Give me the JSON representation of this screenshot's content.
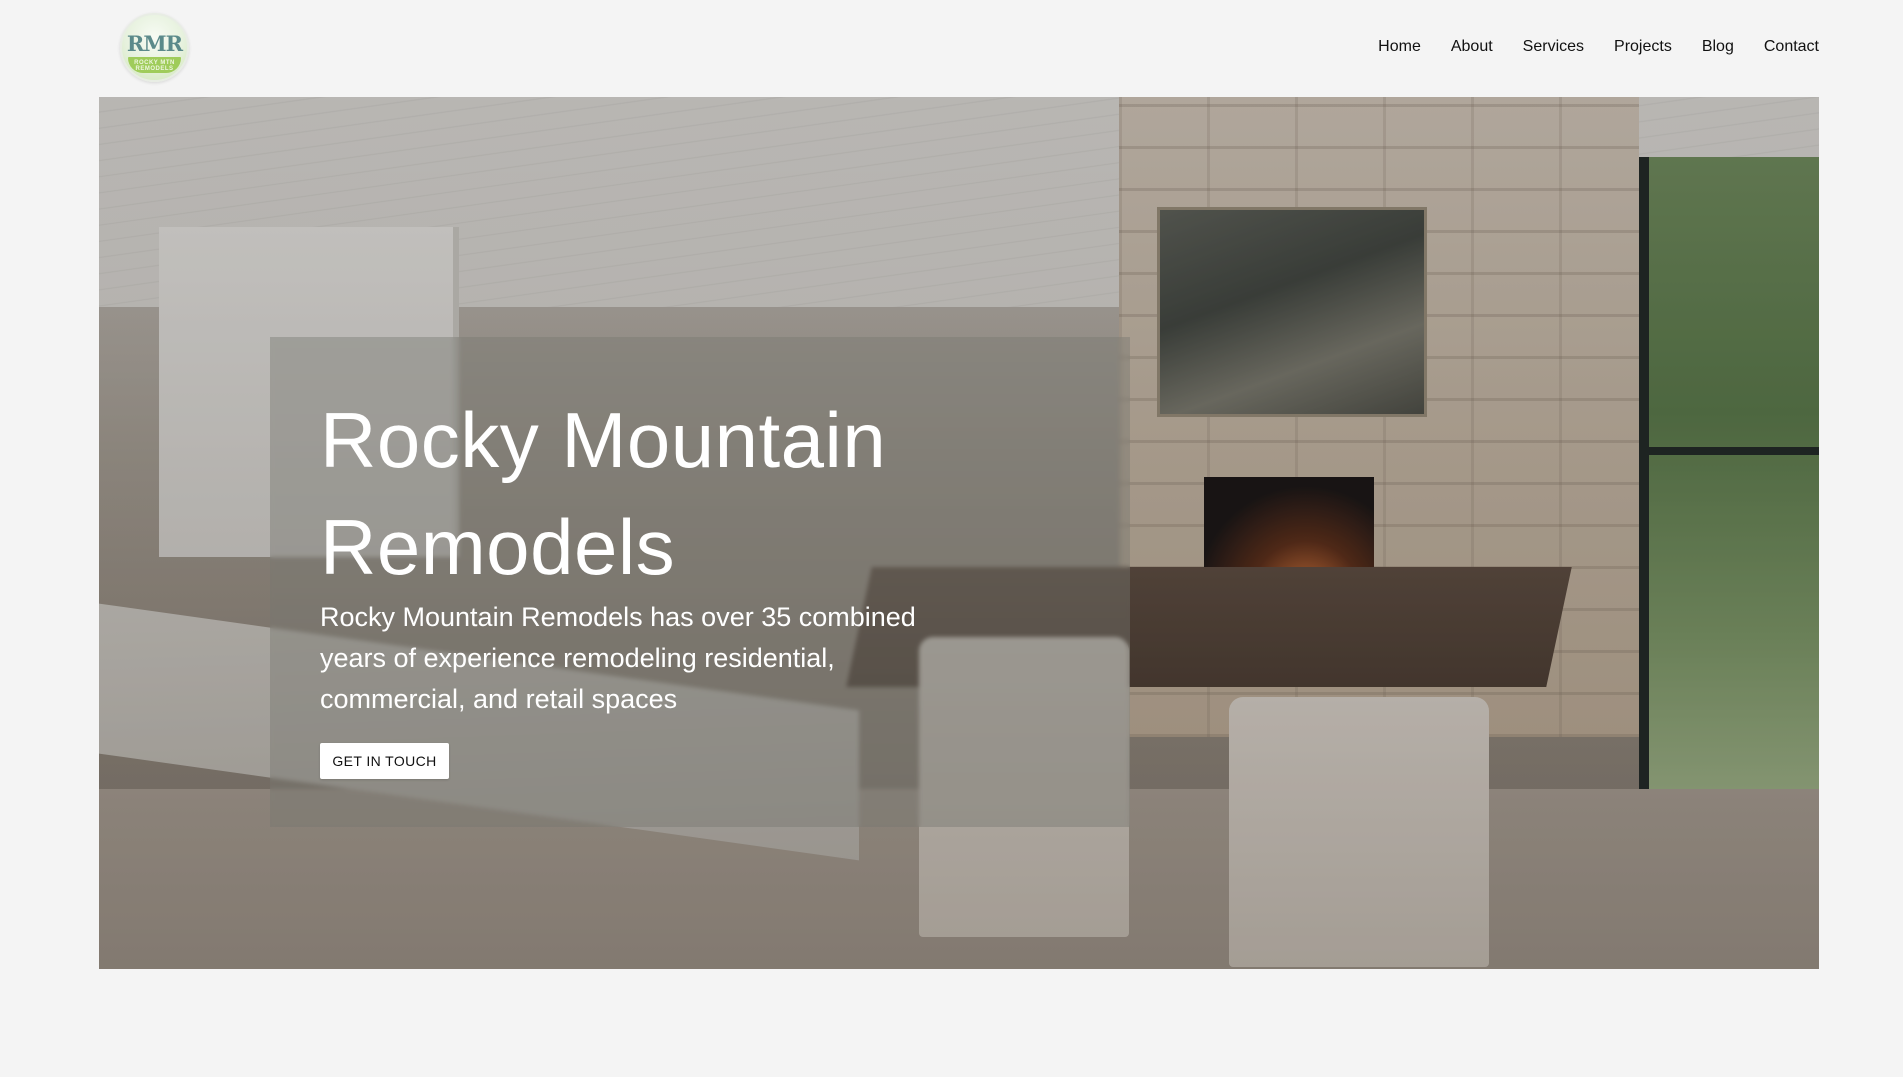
{
  "logo": {
    "monogram": "RMR",
    "band_text": "ROCKY MTN REMODELS"
  },
  "nav": {
    "items": [
      "Home",
      "About",
      "Services",
      "Projects",
      "Blog",
      "Contact"
    ]
  },
  "hero": {
    "title": "Rocky Mountain Remodels",
    "description": "Rocky Mountain Remodels has over 35 combined years of experience remodeling residential, commercial, and retail spaces",
    "cta_label": "GET IN TOUCH",
    "image_subject": "kitchen-dining-room-with-stone-fireplace"
  },
  "colors": {
    "page_background": "#f4f4f4",
    "hero_text": "#ffffff",
    "button_background": "#ffffff",
    "logo_accent": "#9fcc5a"
  }
}
